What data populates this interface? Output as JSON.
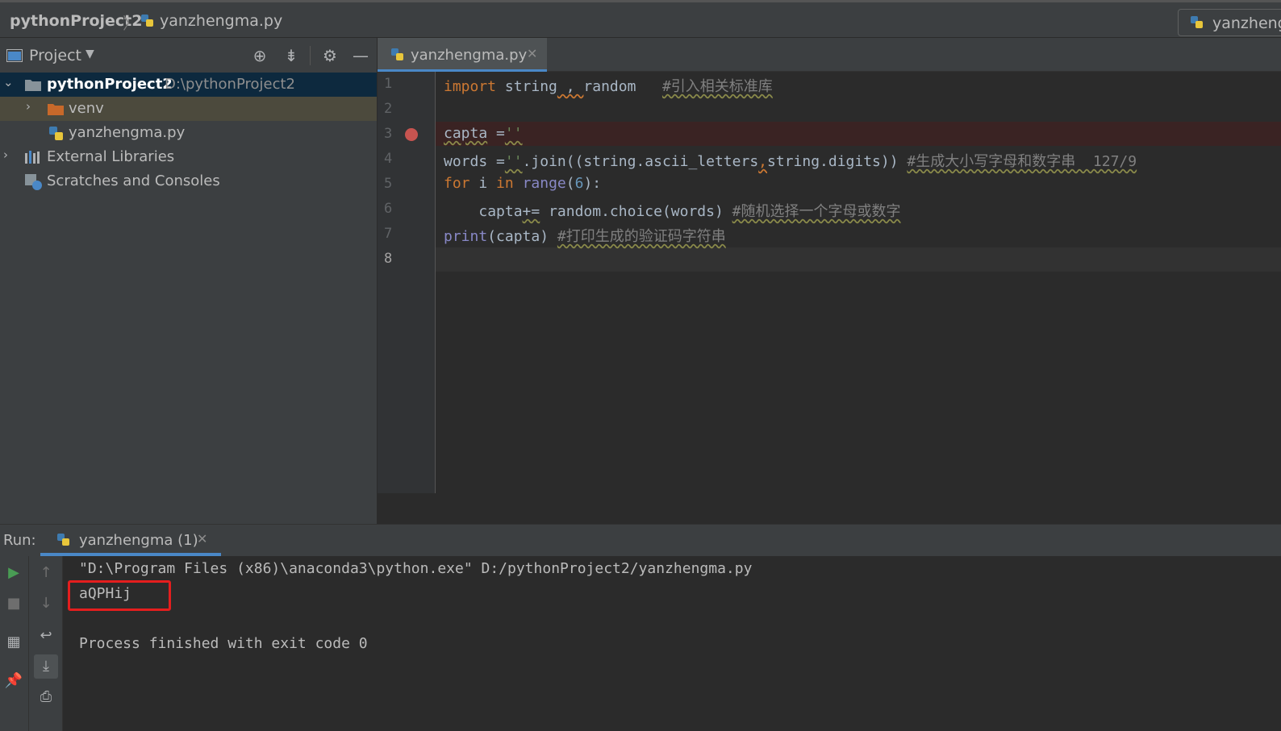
{
  "breadcrumb": {
    "project": "pythonProject2",
    "file": "yanzhengma.py"
  },
  "run_config": {
    "label": "yanzhengma"
  },
  "project_panel": {
    "title": "Project",
    "tree": [
      {
        "label": "pythonProject2",
        "path": "D:\\pythonProject2"
      },
      {
        "label": "venv"
      },
      {
        "label": "yanzhengma.py"
      },
      {
        "label": "External Libraries"
      },
      {
        "label": "Scratches and Consoles"
      }
    ]
  },
  "editor": {
    "tab_label": "yanzhengma.py",
    "line_numbers": [
      "1",
      "2",
      "3",
      "4",
      "5",
      "6",
      "7",
      "8"
    ],
    "lines": {
      "l1": {
        "kw": "import",
        "mid": " string",
        "comma": " , ",
        "rest": "random",
        "comment": "#引入相关标准库"
      },
      "l3": {
        "var": "capta",
        "eq": " =",
        "str": "''"
      },
      "l4": {
        "var": "words",
        "eq": " =",
        "str": "''",
        "rest": ".join((string.ascii_letters",
        "comma": ",",
        "rest2": "string.digits)) ",
        "comment": "#生成大小写字母和数字串  127/9"
      },
      "l5": {
        "kw1": "for",
        "mid": " i ",
        "kw2": "in",
        "sp": " ",
        "bi": "range",
        "p1": "(",
        "num": "6",
        "p2": "):"
      },
      "l6": {
        "indent": "    ",
        "var": "capta",
        "op": "+=",
        "rest": " random.choice(words) ",
        "comment": "#随机选择一个字母或数字"
      },
      "l7": {
        "bi": "print",
        "rest": "(capta) ",
        "comment": "#打印生成的验证码字符串"
      }
    }
  },
  "run_panel": {
    "label": "Run:",
    "tab_label": "yanzhengma (1)",
    "output": [
      "\"D:\\Program Files (x86)\\anaconda3\\python.exe\" D:/pythonProject2/yanzhengma.py",
      "aQPHij",
      "",
      "Process finished with exit code 0"
    ]
  },
  "colors": {
    "highlight_box": "#e41e1e",
    "breakpoint": "#c75450",
    "accent": "#4a88c7"
  }
}
